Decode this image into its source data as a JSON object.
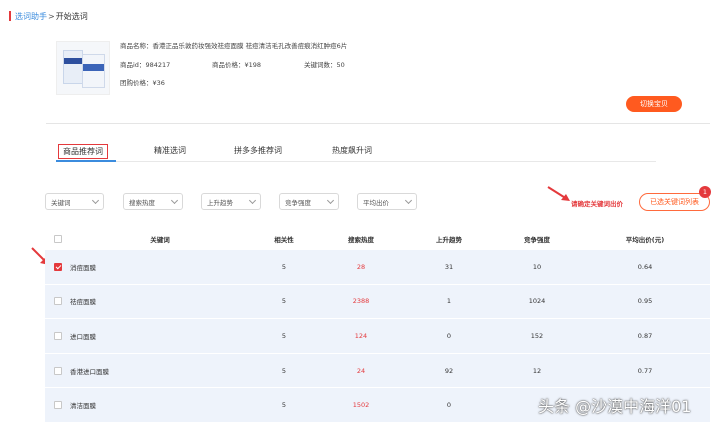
{
  "breadcrumb": {
    "root": "选词助手",
    "separator": ">",
    "current": "开始选词"
  },
  "product": {
    "name_label": "商品名称：",
    "name": "香港正品乐敦药妆强效祛痘面膜 祛痘清洁毛孔改善痘痕消红肿痘6片",
    "id_label": "商品id：",
    "id": "984217",
    "price_label": "商品价格：",
    "price": "¥198",
    "keyword_count_label": "关键词数：",
    "keyword_count": "50",
    "group_price_label": "团购价格：",
    "group_price": "¥36"
  },
  "switch_button": "切换宝贝",
  "tabs": [
    "商品推荐词",
    "精准选词",
    "拼多多推荐词",
    "热度飙升词"
  ],
  "active_tab": 0,
  "filters": [
    "关键词",
    "搜索热度",
    "上升趋势",
    "竞争强度",
    "平均出价"
  ],
  "hint_text": "请确定关键词出价",
  "selected_list_button": "已选关键词列表",
  "selected_count": "1",
  "table": {
    "headers": [
      "关键词",
      "相关性",
      "搜索热度",
      "上升趋势",
      "竞争强度",
      "平均出价(元)"
    ],
    "rows": [
      {
        "checked": true,
        "keyword": "消痘面膜",
        "relevance": "5",
        "heat": "28",
        "trend": "31",
        "competition": "10",
        "bid": "0.64"
      },
      {
        "checked": false,
        "keyword": "祛痘面膜",
        "relevance": "5",
        "heat": "2388",
        "trend": "1",
        "competition": "1024",
        "bid": "0.95"
      },
      {
        "checked": false,
        "keyword": "进口面膜",
        "relevance": "5",
        "heat": "124",
        "trend": "0",
        "competition": "152",
        "bid": "0.87"
      },
      {
        "checked": false,
        "keyword": "香港进口面膜",
        "relevance": "5",
        "heat": "24",
        "trend": "92",
        "competition": "12",
        "bid": "0.77"
      },
      {
        "checked": false,
        "keyword": "清洁面膜",
        "relevance": "5",
        "heat": "1502",
        "trend": "0",
        "competition": "",
        "bid": ""
      }
    ]
  },
  "watermark": "头条 @沙漠中海洋01",
  "colors": {
    "accent_red": "#e4393c",
    "accent_orange": "#ff5a1f",
    "link_blue": "#3b8cde",
    "row_bg": "#eef3fb"
  }
}
